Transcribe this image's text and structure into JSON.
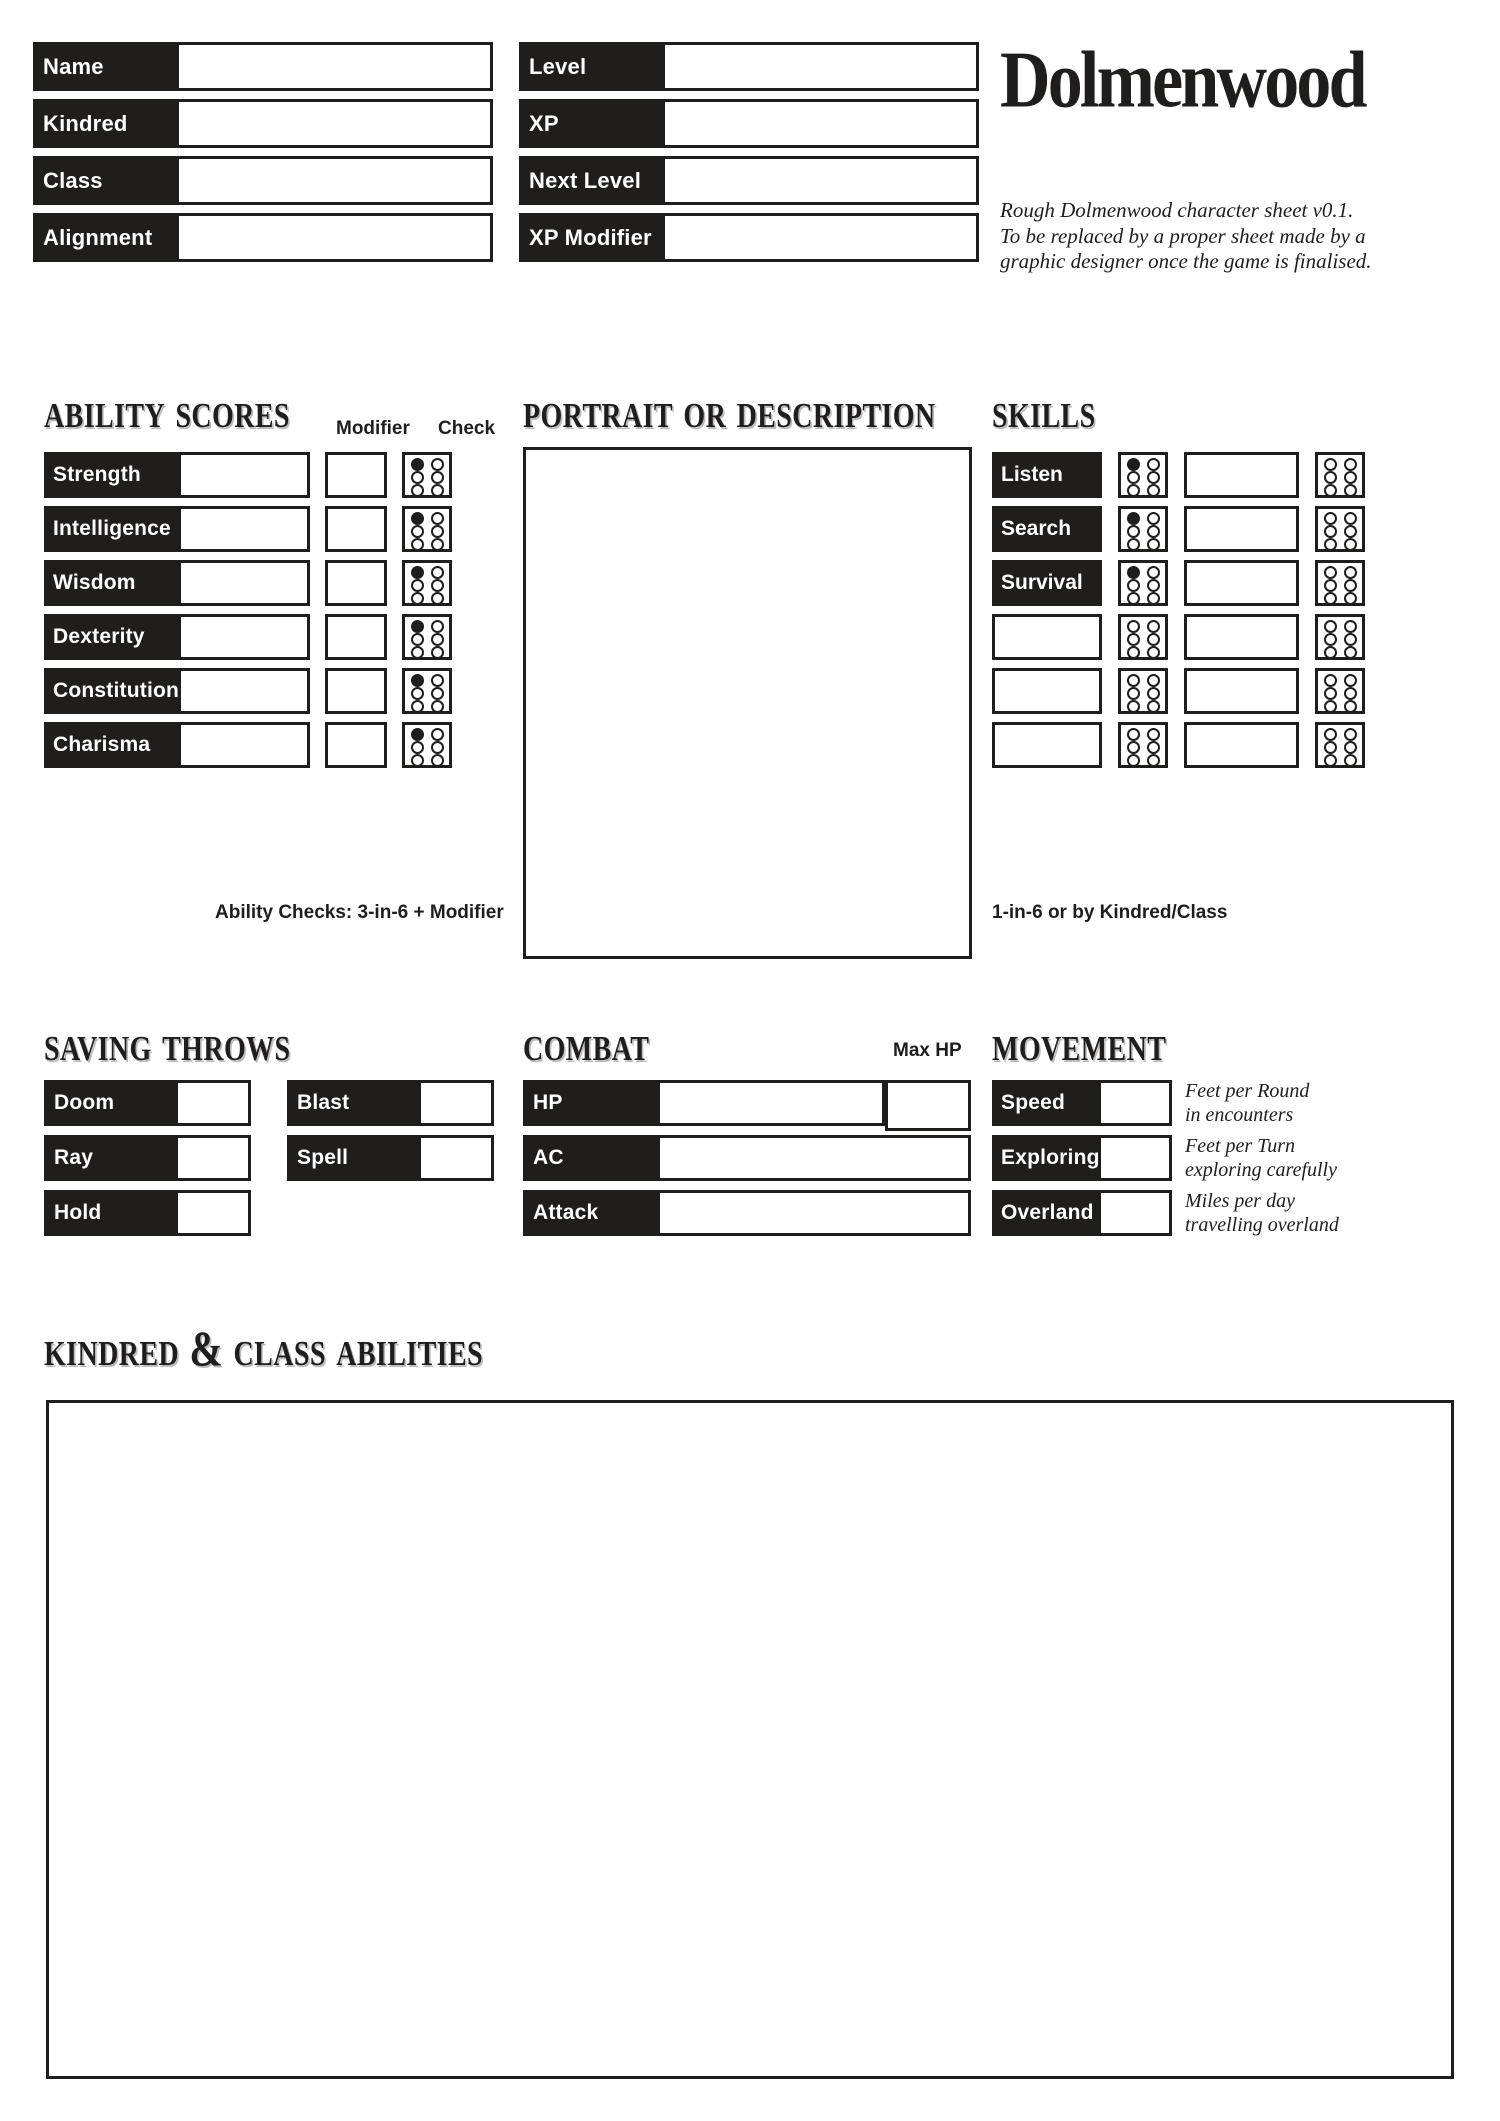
{
  "meta": {
    "logo_text": "Dolmenwood",
    "blurb_line1": "Rough Dolmenwood character sheet v0.1.",
    "blurb_line2": "To be replaced by a proper sheet made by a",
    "blurb_line3": "graphic designer once the game is finalised.",
    "ink": "#201d1d",
    "paper": "#ffffff"
  },
  "identity": {
    "left_fields": [
      {
        "label": "Name",
        "value": ""
      },
      {
        "label": "Kindred",
        "value": ""
      },
      {
        "label": "Class",
        "value": ""
      },
      {
        "label": "Alignment",
        "value": ""
      }
    ],
    "right_fields": [
      {
        "label": "Level",
        "value": ""
      },
      {
        "label": "XP",
        "value": ""
      },
      {
        "label": "Next Level",
        "value": ""
      },
      {
        "label": "XP Modifier",
        "value": ""
      }
    ]
  },
  "ability_scores": {
    "title": "Ability Scores",
    "col_modifier": "Modifier",
    "col_check": "Check",
    "footnote": "Ability Checks: 3-in-6 + Modifier",
    "rows": [
      {
        "label": "Strength",
        "score": "",
        "modifier": "",
        "check_pips": [
          1,
          0,
          0,
          0,
          0,
          0
        ]
      },
      {
        "label": "Intelligence",
        "score": "",
        "modifier": "",
        "check_pips": [
          1,
          0,
          0,
          0,
          0,
          0
        ]
      },
      {
        "label": "Wisdom",
        "score": "",
        "modifier": "",
        "check_pips": [
          1,
          0,
          0,
          0,
          0,
          0
        ]
      },
      {
        "label": "Dexterity",
        "score": "",
        "modifier": "",
        "check_pips": [
          1,
          0,
          0,
          0,
          0,
          0
        ]
      },
      {
        "label": "Constitution",
        "score": "",
        "modifier": "",
        "check_pips": [
          1,
          0,
          0,
          0,
          0,
          0
        ]
      },
      {
        "label": "Charisma",
        "score": "",
        "modifier": "",
        "check_pips": [
          1,
          0,
          0,
          0,
          0,
          0
        ]
      }
    ]
  },
  "portrait": {
    "title": "Portrait or Description",
    "content": ""
  },
  "skills": {
    "title": "Skills",
    "footnote": "1-in-6 or by Kindred/Class",
    "rows": [
      {
        "label": "Listen",
        "pips_a": [
          1,
          0,
          0,
          0,
          0,
          0
        ],
        "value": "",
        "pips_b": [
          0,
          0,
          0,
          0,
          0,
          0
        ]
      },
      {
        "label": "Search",
        "pips_a": [
          1,
          0,
          0,
          0,
          0,
          0
        ],
        "value": "",
        "pips_b": [
          0,
          0,
          0,
          0,
          0,
          0
        ]
      },
      {
        "label": "Survival",
        "pips_a": [
          1,
          0,
          0,
          0,
          0,
          0
        ],
        "value": "",
        "pips_b": [
          0,
          0,
          0,
          0,
          0,
          0
        ]
      },
      {
        "label": "",
        "pips_a": [
          0,
          0,
          0,
          0,
          0,
          0
        ],
        "value": "",
        "pips_b": [
          0,
          0,
          0,
          0,
          0,
          0
        ]
      },
      {
        "label": "",
        "pips_a": [
          0,
          0,
          0,
          0,
          0,
          0
        ],
        "value": "",
        "pips_b": [
          0,
          0,
          0,
          0,
          0,
          0
        ]
      },
      {
        "label": "",
        "pips_a": [
          0,
          0,
          0,
          0,
          0,
          0
        ],
        "value": "",
        "pips_b": [
          0,
          0,
          0,
          0,
          0,
          0
        ]
      }
    ]
  },
  "saving_throws": {
    "title": "Saving Throws",
    "left_rows": [
      {
        "label": "Doom",
        "value": ""
      },
      {
        "label": "Ray",
        "value": ""
      },
      {
        "label": "Hold",
        "value": ""
      }
    ],
    "right_rows": [
      {
        "label": "Blast",
        "value": ""
      },
      {
        "label": "Spell",
        "value": ""
      }
    ]
  },
  "combat": {
    "title": "Combat",
    "max_hp_label": "Max HP",
    "max_hp_value": "",
    "rows": [
      {
        "label": "HP",
        "value": ""
      },
      {
        "label": "AC",
        "value": ""
      },
      {
        "label": "Attack",
        "value": ""
      }
    ]
  },
  "movement": {
    "title": "Movement",
    "rows": [
      {
        "label": "Speed",
        "value": "",
        "hint_line1": "Feet per Round",
        "hint_line2": "in encounters"
      },
      {
        "label": "Exploring",
        "value": "",
        "hint_line1": "Feet per Turn",
        "hint_line2": "exploring carefully"
      },
      {
        "label": "Overland",
        "value": "",
        "hint_line1": "Miles per day",
        "hint_line2": "travelling overland"
      }
    ]
  },
  "kindred_class_abilities": {
    "title": "Kindred & Class Abilities",
    "content": ""
  }
}
